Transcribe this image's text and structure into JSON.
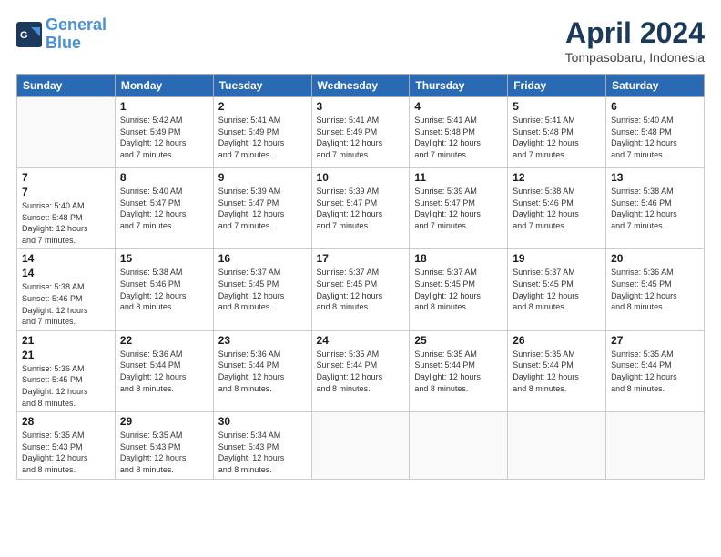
{
  "header": {
    "logo_line1": "General",
    "logo_line2": "Blue",
    "month_title": "April 2024",
    "subtitle": "Tompasobaru, Indonesia"
  },
  "weekdays": [
    "Sunday",
    "Monday",
    "Tuesday",
    "Wednesday",
    "Thursday",
    "Friday",
    "Saturday"
  ],
  "weeks": [
    [
      {
        "day": "",
        "info": ""
      },
      {
        "day": "1",
        "info": "Sunrise: 5:42 AM\nSunset: 5:49 PM\nDaylight: 12 hours\nand 7 minutes."
      },
      {
        "day": "2",
        "info": "Sunrise: 5:41 AM\nSunset: 5:49 PM\nDaylight: 12 hours\nand 7 minutes."
      },
      {
        "day": "3",
        "info": "Sunrise: 5:41 AM\nSunset: 5:49 PM\nDaylight: 12 hours\nand 7 minutes."
      },
      {
        "day": "4",
        "info": "Sunrise: 5:41 AM\nSunset: 5:48 PM\nDaylight: 12 hours\nand 7 minutes."
      },
      {
        "day": "5",
        "info": "Sunrise: 5:41 AM\nSunset: 5:48 PM\nDaylight: 12 hours\nand 7 minutes."
      },
      {
        "day": "6",
        "info": "Sunrise: 5:40 AM\nSunset: 5:48 PM\nDaylight: 12 hours\nand 7 minutes."
      }
    ],
    [
      {
        "day": "7",
        "info": ""
      },
      {
        "day": "8",
        "info": "Sunrise: 5:40 AM\nSunset: 5:47 PM\nDaylight: 12 hours\nand 7 minutes."
      },
      {
        "day": "9",
        "info": "Sunrise: 5:39 AM\nSunset: 5:47 PM\nDaylight: 12 hours\nand 7 minutes."
      },
      {
        "day": "10",
        "info": "Sunrise: 5:39 AM\nSunset: 5:47 PM\nDaylight: 12 hours\nand 7 minutes."
      },
      {
        "day": "11",
        "info": "Sunrise: 5:39 AM\nSunset: 5:47 PM\nDaylight: 12 hours\nand 7 minutes."
      },
      {
        "day": "12",
        "info": "Sunrise: 5:38 AM\nSunset: 5:46 PM\nDaylight: 12 hours\nand 7 minutes."
      },
      {
        "day": "13",
        "info": "Sunrise: 5:38 AM\nSunset: 5:46 PM\nDaylight: 12 hours\nand 7 minutes."
      }
    ],
    [
      {
        "day": "14",
        "info": ""
      },
      {
        "day": "15",
        "info": "Sunrise: 5:38 AM\nSunset: 5:46 PM\nDaylight: 12 hours\nand 8 minutes."
      },
      {
        "day": "16",
        "info": "Sunrise: 5:37 AM\nSunset: 5:45 PM\nDaylight: 12 hours\nand 8 minutes."
      },
      {
        "day": "17",
        "info": "Sunrise: 5:37 AM\nSunset: 5:45 PM\nDaylight: 12 hours\nand 8 minutes."
      },
      {
        "day": "18",
        "info": "Sunrise: 5:37 AM\nSunset: 5:45 PM\nDaylight: 12 hours\nand 8 minutes."
      },
      {
        "day": "19",
        "info": "Sunrise: 5:37 AM\nSunset: 5:45 PM\nDaylight: 12 hours\nand 8 minutes."
      },
      {
        "day": "20",
        "info": "Sunrise: 5:36 AM\nSunset: 5:45 PM\nDaylight: 12 hours\nand 8 minutes."
      }
    ],
    [
      {
        "day": "21",
        "info": ""
      },
      {
        "day": "22",
        "info": "Sunrise: 5:36 AM\nSunset: 5:44 PM\nDaylight: 12 hours\nand 8 minutes."
      },
      {
        "day": "23",
        "info": "Sunrise: 5:36 AM\nSunset: 5:44 PM\nDaylight: 12 hours\nand 8 minutes."
      },
      {
        "day": "24",
        "info": "Sunrise: 5:35 AM\nSunset: 5:44 PM\nDaylight: 12 hours\nand 8 minutes."
      },
      {
        "day": "25",
        "info": "Sunrise: 5:35 AM\nSunset: 5:44 PM\nDaylight: 12 hours\nand 8 minutes."
      },
      {
        "day": "26",
        "info": "Sunrise: 5:35 AM\nSunset: 5:44 PM\nDaylight: 12 hours\nand 8 minutes."
      },
      {
        "day": "27",
        "info": "Sunrise: 5:35 AM\nSunset: 5:44 PM\nDaylight: 12 hours\nand 8 minutes."
      }
    ],
    [
      {
        "day": "28",
        "info": "Sunrise: 5:35 AM\nSunset: 5:43 PM\nDaylight: 12 hours\nand 8 minutes."
      },
      {
        "day": "29",
        "info": "Sunrise: 5:35 AM\nSunset: 5:43 PM\nDaylight: 12 hours\nand 8 minutes."
      },
      {
        "day": "30",
        "info": "Sunrise: 5:34 AM\nSunset: 5:43 PM\nDaylight: 12 hours\nand 8 minutes."
      },
      {
        "day": "",
        "info": ""
      },
      {
        "day": "",
        "info": ""
      },
      {
        "day": "",
        "info": ""
      },
      {
        "day": "",
        "info": ""
      }
    ]
  ]
}
